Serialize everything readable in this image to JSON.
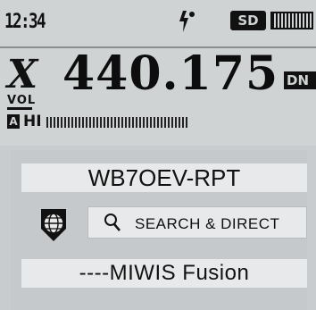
{
  "status": {
    "clock": "12:34",
    "sd_badge": "SD"
  },
  "frequency": {
    "band": "X",
    "value": "440.175",
    "mode": "DN"
  },
  "meters": {
    "vol_label": "VOL",
    "vol_level": 0.35,
    "channel_marker": "A",
    "power": "HI",
    "signal_level": 1.0
  },
  "wires": {
    "node_callsign": "WB7OEV-RPT",
    "search_label": "SEARCH & DIRECT",
    "room_name": "----MIWIS  Fusion"
  },
  "icons": {
    "gps": "gps-icon",
    "sd": "sd-card-icon",
    "battery": "battery-icon",
    "globe": "globe-icon",
    "search": "search-icon"
  }
}
